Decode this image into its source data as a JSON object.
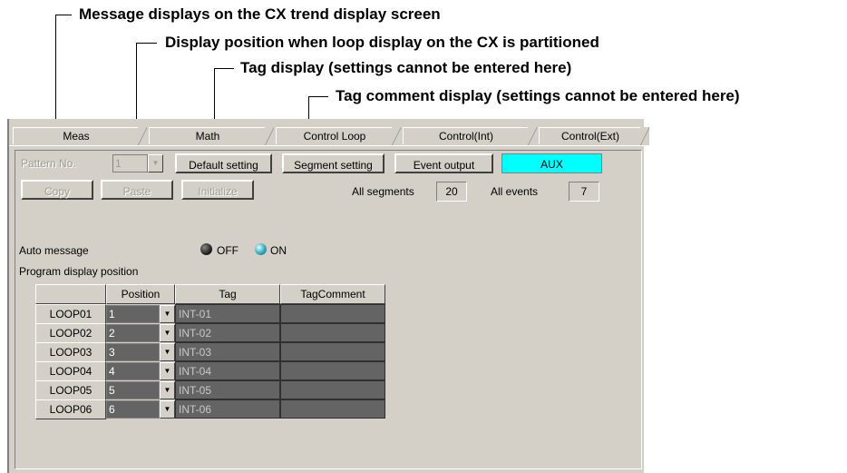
{
  "callouts": {
    "c1": "Message displays on the CX trend display screen",
    "c2": "Display position when loop display on the CX is partitioned",
    "c3": "Tag display (settings cannot be entered here)",
    "c4": "Tag comment display (settings cannot be entered here)"
  },
  "tabs": [
    "Meas",
    "Math",
    "Control Loop",
    "Control(Int)",
    "Control(Ext)"
  ],
  "toolbar": {
    "pattern_label": "Pattern No.",
    "pattern_value": "1",
    "default_setting": "Default setting",
    "segment_setting": "Segment setting",
    "event_output": "Event output",
    "aux": "AUX",
    "copy": "Copy",
    "paste": "Paste",
    "initialize": "Initialize",
    "all_segments_label": "All segments",
    "all_segments_value": "20",
    "all_events_label": "All events",
    "all_events_value": "7"
  },
  "auto_message": {
    "label": "Auto message",
    "off": "OFF",
    "on": "ON"
  },
  "program_display": {
    "label": "Program display position",
    "headers": [
      "Position",
      "Tag",
      "TagComment"
    ],
    "rows": [
      {
        "loop": "LOOP01",
        "position": "1",
        "tag": "INT-01",
        "comment": ""
      },
      {
        "loop": "LOOP02",
        "position": "2",
        "tag": "INT-02",
        "comment": ""
      },
      {
        "loop": "LOOP03",
        "position": "3",
        "tag": "INT-03",
        "comment": ""
      },
      {
        "loop": "LOOP04",
        "position": "4",
        "tag": "INT-04",
        "comment": ""
      },
      {
        "loop": "LOOP05",
        "position": "5",
        "tag": "INT-05",
        "comment": ""
      },
      {
        "loop": "LOOP06",
        "position": "6",
        "tag": "INT-06",
        "comment": ""
      }
    ]
  },
  "colors": {
    "panel": "#d4d0c8",
    "aux": "#00ffff",
    "cell_dark": "#646464"
  }
}
